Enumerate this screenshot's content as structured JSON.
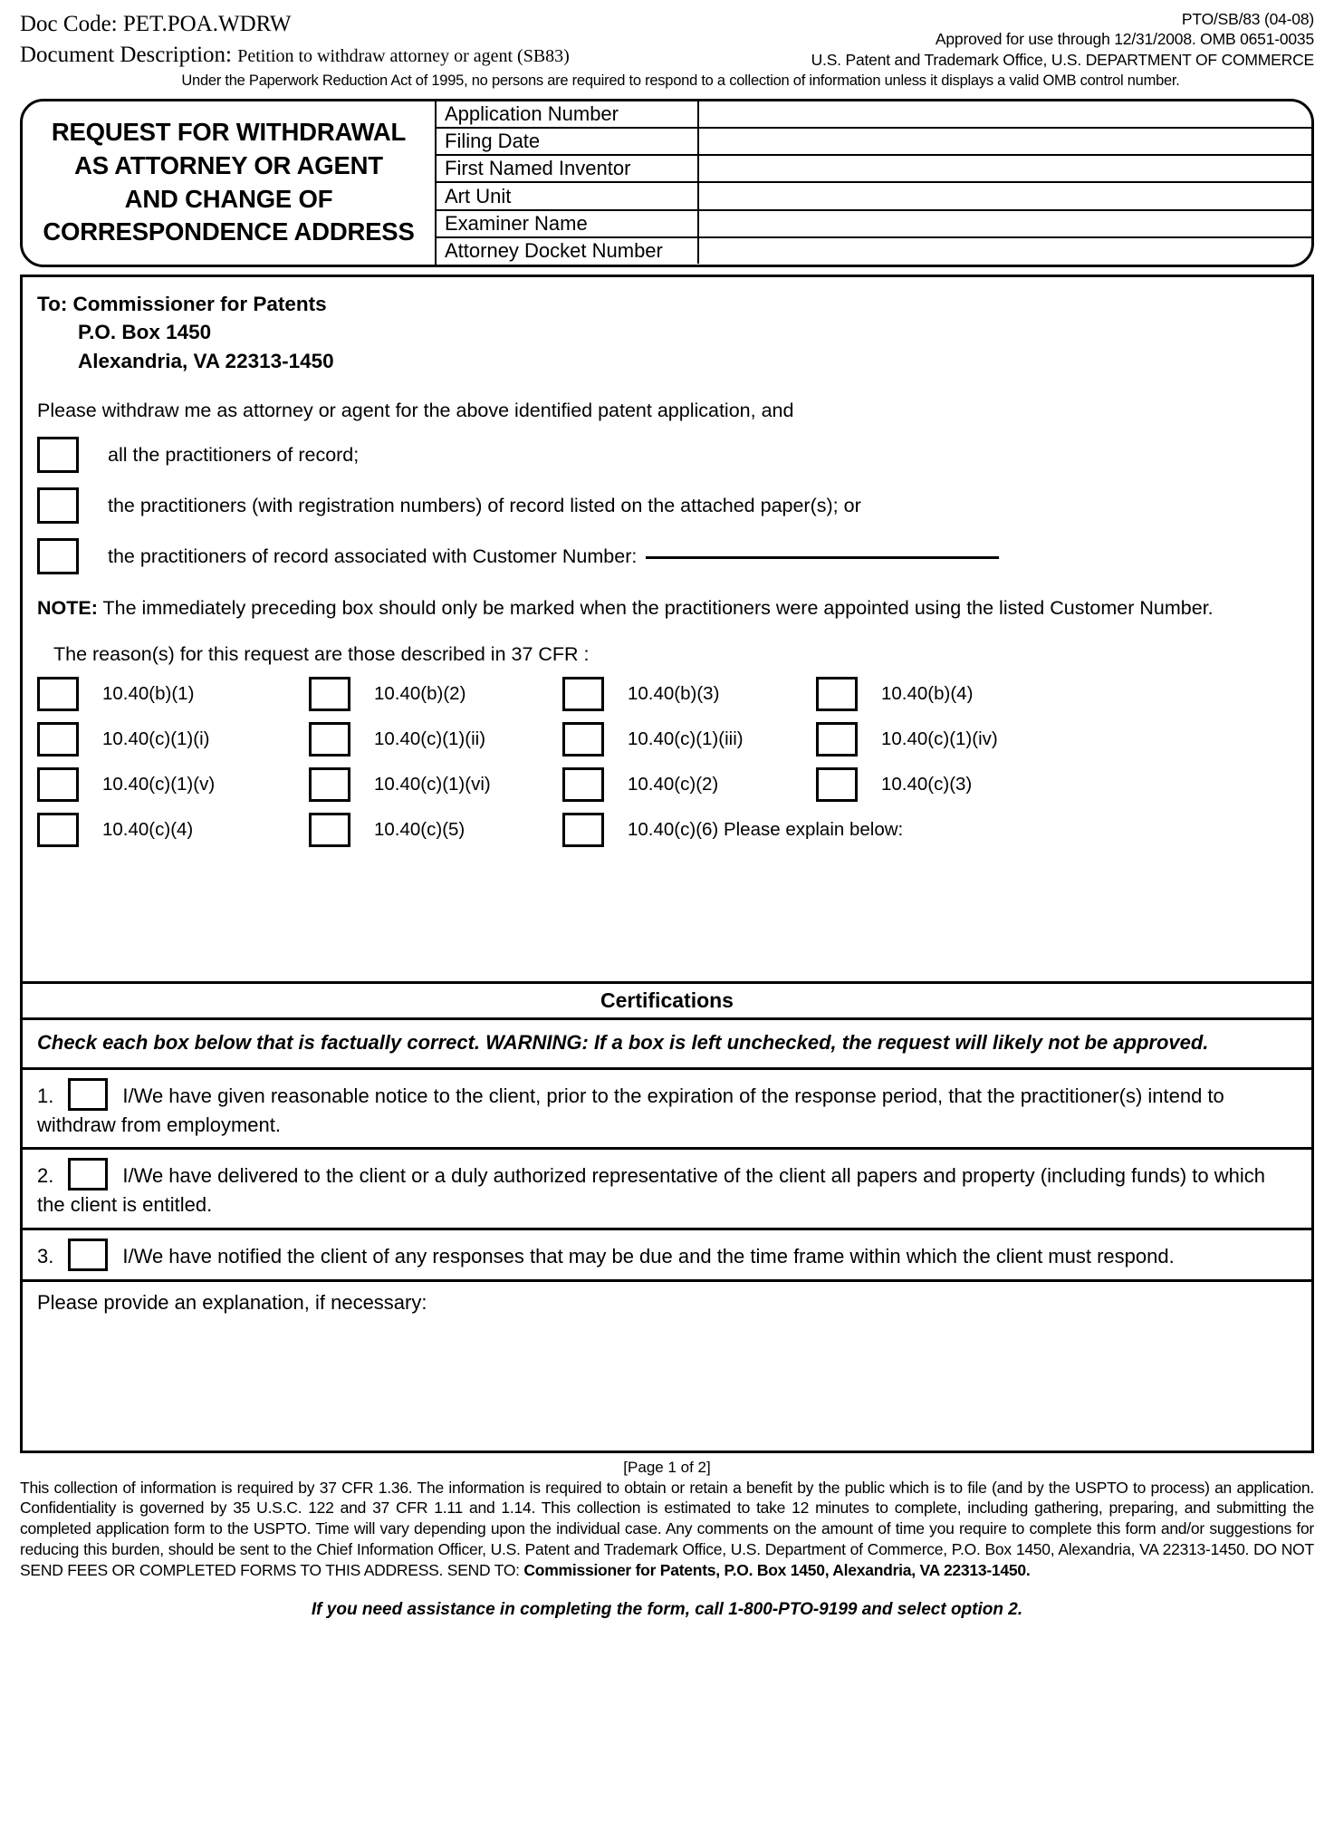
{
  "header": {
    "doc_code_label": "Doc Code:",
    "doc_code_value": "PET.POA.WDRW",
    "doc_desc_label": "Document Description:",
    "doc_desc_value": "Petition to withdraw attorney or agent (SB83)",
    "form_number": "PTO/SB/83 (04-08)",
    "approved_line": "Approved for use through 12/31/2008. OMB 0651-0035",
    "office_line": "U.S. Patent and Trademark Office, U.S. DEPARTMENT OF COMMERCE",
    "paperwork_notice": "Under the Paperwork Reduction Act of 1995, no persons are required to respond to a collection of information unless it displays a valid OMB control number."
  },
  "title_block": {
    "title_line1": "REQUEST FOR WITHDRAWAL",
    "title_line2": "AS ATTORNEY OR AGENT",
    "title_line3": "AND CHANGE OF",
    "title_line4": "CORRESPONDENCE ADDRESS",
    "fields": [
      {
        "label": "Application Number",
        "value": ""
      },
      {
        "label": "Filing Date",
        "value": ""
      },
      {
        "label": "First Named Inventor",
        "value": ""
      },
      {
        "label": "Art Unit",
        "value": ""
      },
      {
        "label": "Examiner Name",
        "value": ""
      },
      {
        "label": "Attorney Docket Number",
        "value": ""
      }
    ]
  },
  "body": {
    "to_label": "To:  Commissioner for Patents",
    "to_line2": "P.O. Box 1450",
    "to_line3": "Alexandria, VA 22313-1450",
    "lead": "Please withdraw me as attorney or agent for the above identified patent application, and",
    "options": [
      {
        "label": "all the practitioners of record;",
        "checked": false
      },
      {
        "label": "the practitioners (with registration numbers) of record listed on the attached paper(s); or",
        "checked": false
      },
      {
        "label": "the practitioners of record associated with Customer Number:",
        "checked": false,
        "has_rule": true
      }
    ],
    "note_bold": "NOTE:",
    "note_text": " The immediately preceding box should only be marked when the practitioners were appointed using the listed Customer Number.",
    "reasons_lead": "The reason(s) for this request are those described in 37 CFR :",
    "reason_rows": [
      [
        "10.40(b)(1)",
        "10.40(b)(2)",
        "10.40(b)(3)",
        "10.40(b)(4)"
      ],
      [
        "10.40(c)(1)(i)",
        "10.40(c)(1)(ii)",
        "10.40(c)(1)(iii)",
        "10.40(c)(1)(iv)"
      ],
      [
        "10.40(c)(1)(v)",
        "10.40(c)(1)(vi)",
        "10.40(c)(2)",
        "10.40(c)(3)"
      ],
      [
        "10.40(c)(4)",
        "10.40(c)(5)",
        "10.40(c)(6) Please explain below:",
        ""
      ]
    ]
  },
  "certifications": {
    "heading": "Certifications",
    "warning": "Check each box below that is factually correct.  WARNING: If a box is left unchecked, the request will likely not be approved.",
    "items": [
      {
        "num": "1.",
        "text": "I/We have given reasonable notice to the client, prior to the expiration of the response period, that the practitioner(s) intend to withdraw from employment."
      },
      {
        "num": "2.",
        "text": "I/We have delivered to the client or a duly authorized representative of the client all papers and property (including funds) to which the client is entitled."
      },
      {
        "num": "3.",
        "text": "I/We have notified the client of any responses that may be due and the time frame within which the client must respond."
      }
    ],
    "explain_label": "Please provide an explanation, if necessary:"
  },
  "footer": {
    "page_of": "[Page 1 of 2]",
    "fine_print_part1": "This collection of information is required by 37 CFR 1.36. The information is required to obtain or retain a benefit by the public which is to file (and by the USPTO to process) an application. Confidentiality is governed by 35 U.S.C. 122 and 37 CFR 1.11 and 1.14. This collection is estimated to take 12 minutes to complete, including gathering, preparing, and submitting the completed application form to the USPTO. Time will vary depending upon the individual case. Any comments on the amount of time you require to complete this form and/or suggestions for reducing this burden, should be sent to the Chief Information Officer, U.S. Patent and Trademark Office, U.S. Department of Commerce, P.O. Box 1450, Alexandria, VA  22313-1450. DO NOT SEND FEES OR COMPLETED FORMS TO THIS ADDRESS.  SEND TO: ",
    "fine_print_bold": "Commissioner for Patents, P.O. Box 1450, Alexandria, VA 22313-1450.",
    "assistance": "If you need assistance in completing the form, call 1-800-PTO-9199 and select option 2."
  }
}
